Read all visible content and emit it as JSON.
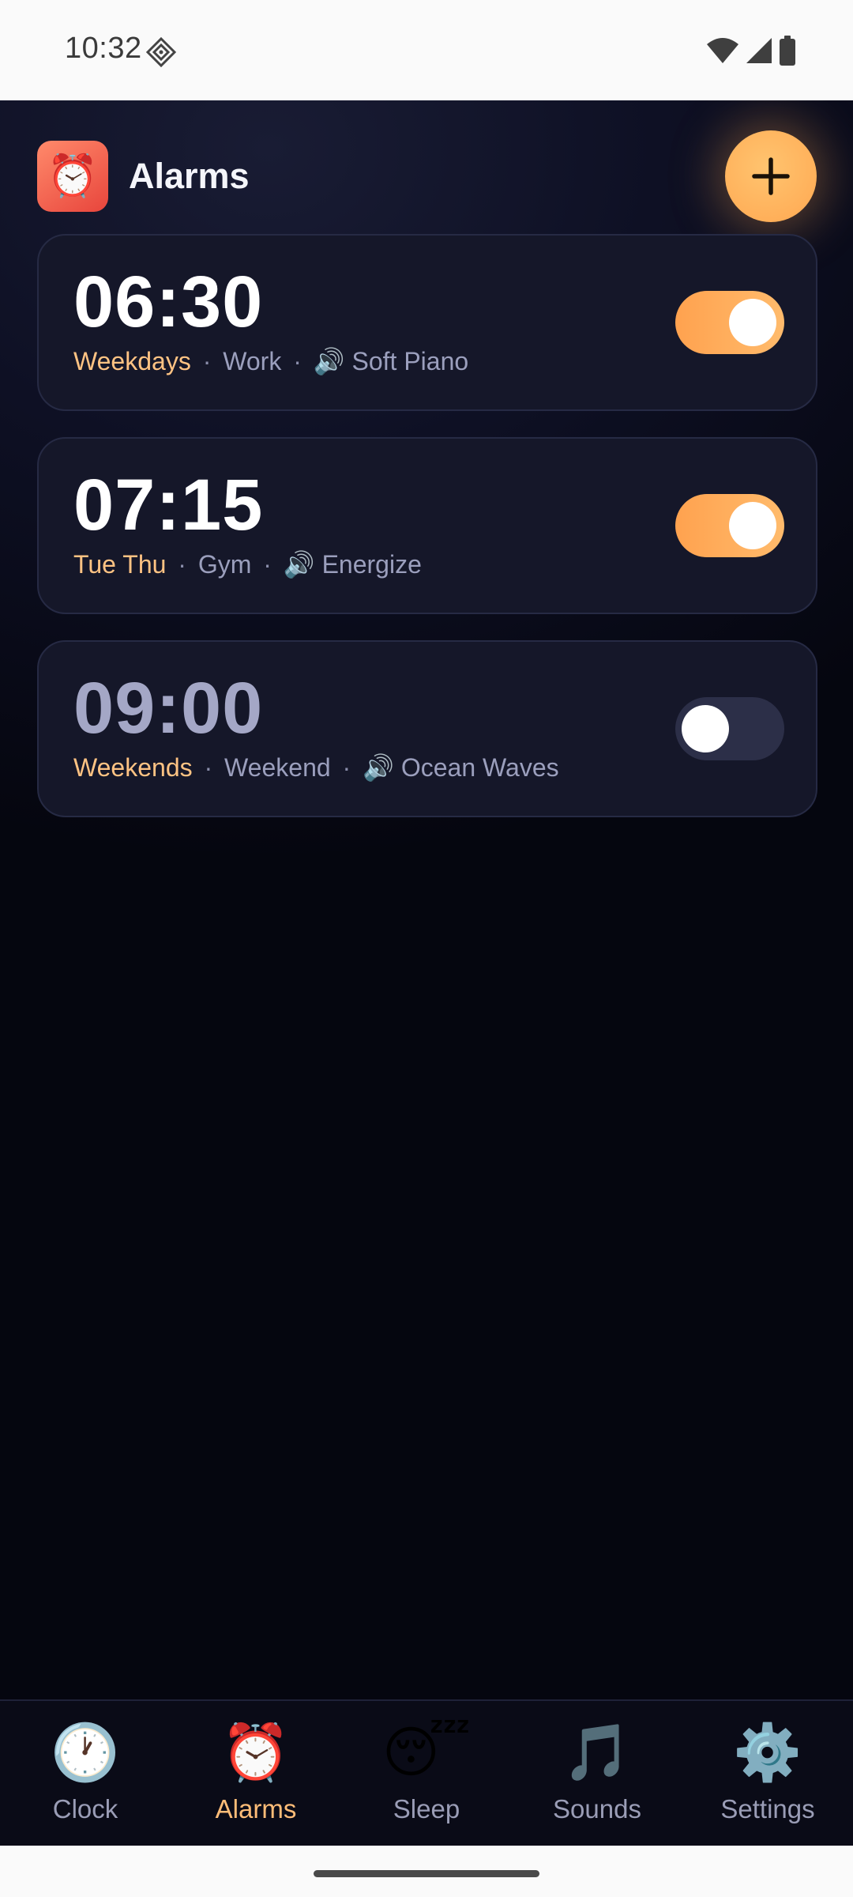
{
  "status_bar": {
    "time": "10:32",
    "icons": [
      "diamond-notification-icon",
      "wifi-icon",
      "signal-icon",
      "battery-icon"
    ]
  },
  "header": {
    "logo_icon": "⏰",
    "title": "Alarms",
    "add_icon": "plus-icon"
  },
  "alarms": [
    {
      "time": "06:30",
      "days": "Weekdays",
      "label": "Work",
      "sound_icon": "🔊",
      "sound": "Soft Piano",
      "enabled": true
    },
    {
      "time": "07:15",
      "days": "Tue Thu",
      "label": "Gym",
      "sound_icon": "🔊",
      "sound": "Energize",
      "enabled": true
    },
    {
      "time": "09:00",
      "days": "Weekends",
      "label": "Weekend",
      "sound_icon": "🔊",
      "sound": "Ocean Waves",
      "enabled": false
    }
  ],
  "separator": "·",
  "nav": {
    "items": [
      {
        "icon": "🕐",
        "label": "Clock"
      },
      {
        "icon": "⏰",
        "label": "Alarms"
      },
      {
        "icon": "😴",
        "label": "Sleep"
      },
      {
        "icon": "🎵",
        "label": "Sounds"
      },
      {
        "icon": "⚙️",
        "label": "Settings"
      }
    ],
    "active": "Alarms"
  },
  "colors": {
    "accent": "#ffb05a",
    "day_text": "#ffc383",
    "card_bg": "#151729",
    "background": "#05060f"
  }
}
